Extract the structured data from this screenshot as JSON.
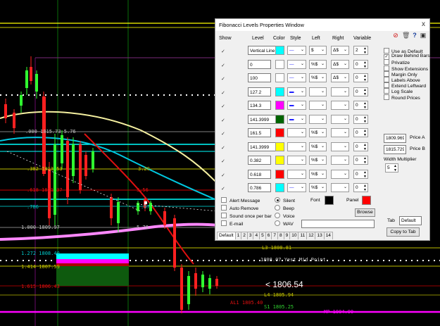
{
  "chart": {
    "price_labels": {
      "fib_0": ".000 1815.73 5.76",
      "fib_382": ".382 1813.53",
      "fib_20": "3.20",
      "fib_618": ".618 1811.37",
      "fib_356": "3.56",
      "fib_786": ".786",
      "fib_57": ".57",
      "fib_1000": "1.000 1809.97",
      "fib_578": "5.78",
      "fib_1272": "1.272 1808.40",
      "fib_1414": "1.414 1807.59",
      "fib_1615": "1.615 1806.43",
      "l3": "L3 1808.81",
      "yest_mid": "1808.07 Yest Mid Point",
      "current_price": "< 1806.54",
      "l4": "L4 1805.94",
      "al1": "AL1 1805.40",
      "s1": "S1 1805.25",
      "mp": "MP-1804.90"
    }
  },
  "window": {
    "title": "Fibonacci Levels Properties Window",
    "close": "x",
    "headers": {
      "show": "Show",
      "level": "Level",
      "color": "Color",
      "style": "Style",
      "left": "Left",
      "right": "Right",
      "variable": "Variable"
    },
    "rows": [
      {
        "show": "✓",
        "level": "Vertical Line",
        "color": "#00ffff",
        "style": "—",
        "left": "$",
        "right": "Δ$",
        "var": "2"
      },
      {
        "show": "✓",
        "level": "0",
        "color": "#ffffff",
        "style": "—",
        "left": "%$",
        "right": "Δ$",
        "var": "0"
      },
      {
        "show": "✓",
        "level": "100",
        "color": "#ffffff",
        "style": "—",
        "left": "%$",
        "right": "Δ$",
        "var": "0"
      },
      {
        "show": "✓",
        "level": "127.2",
        "color": "#00ffff",
        "style": "▬",
        "left": "",
        "right": "",
        "var": "0"
      },
      {
        "show": "✓",
        "level": "134.3",
        "color": "#ff00ff",
        "style": "▬",
        "left": "",
        "right": "",
        "var": "0"
      },
      {
        "show": "✓",
        "level": "141.3999",
        "color": "#006400",
        "style": "▬",
        "left": "",
        "right": "",
        "var": "0"
      },
      {
        "show": "✓",
        "level": "161.5",
        "color": "#ff0000",
        "style": "",
        "left": "%$",
        "right": "",
        "var": "0"
      },
      {
        "show": "✓",
        "level": "141.3999",
        "color": "#ffff00",
        "style": "",
        "left": "%$",
        "right": "",
        "var": "0"
      },
      {
        "show": "✓",
        "level": "0.382",
        "color": "#ffff00",
        "style": "",
        "left": "%$",
        "right": "",
        "var": "0"
      },
      {
        "show": "✓",
        "level": "0.618",
        "color": "#ff0000",
        "style": "",
        "left": "%$",
        "right": "",
        "var": "0"
      },
      {
        "show": "✓",
        "level": "0.786",
        "color": "#00ffff",
        "style": "—",
        "left": "%$",
        "right": "",
        "var": "0"
      }
    ],
    "right_panel": {
      "options": [
        {
          "label": "Use as Default",
          "checked": false
        },
        {
          "label": "Draw Behind Bars",
          "checked": true
        },
        {
          "label": "Privatize",
          "checked": false
        },
        {
          "label": "Show Extensions",
          "checked": false
        },
        {
          "label": "Margin Only",
          "checked": false
        },
        {
          "label": "Labels Above",
          "checked": false
        },
        {
          "label": "Extend Leftward",
          "checked": false
        },
        {
          "label": "Log Scale",
          "checked": false
        },
        {
          "label": "Round Prices",
          "checked": false
        }
      ],
      "price_a_value": "1809.9699",
      "price_a_label": "Price A",
      "price_b_value": "1815.7299",
      "price_b_label": "Price B",
      "width_multiplier_label": "Width Multiplier",
      "width_multiplier_value": "5",
      "tab_label": "Tab",
      "tab_value": "Default",
      "copy_to_tab": "Copy to Tab"
    },
    "alerts": {
      "alert_message": "Alert Message",
      "auto_remove": "Auto Remove",
      "sound_once": "Sound once per bar",
      "email": "E-mail",
      "silent": "Silent",
      "beep": "Beep",
      "voice": "Voice",
      "wav": "WAV",
      "font_label": "Font",
      "panel_label": "Panel",
      "font_color": "#000000",
      "panel_color": "#ff0000",
      "browse": "Browse"
    },
    "tabs": [
      "Default",
      "1",
      "2",
      "3",
      "4",
      "5",
      "6",
      "7",
      "8",
      "9",
      "10",
      "11",
      "12",
      "13",
      "14"
    ]
  }
}
